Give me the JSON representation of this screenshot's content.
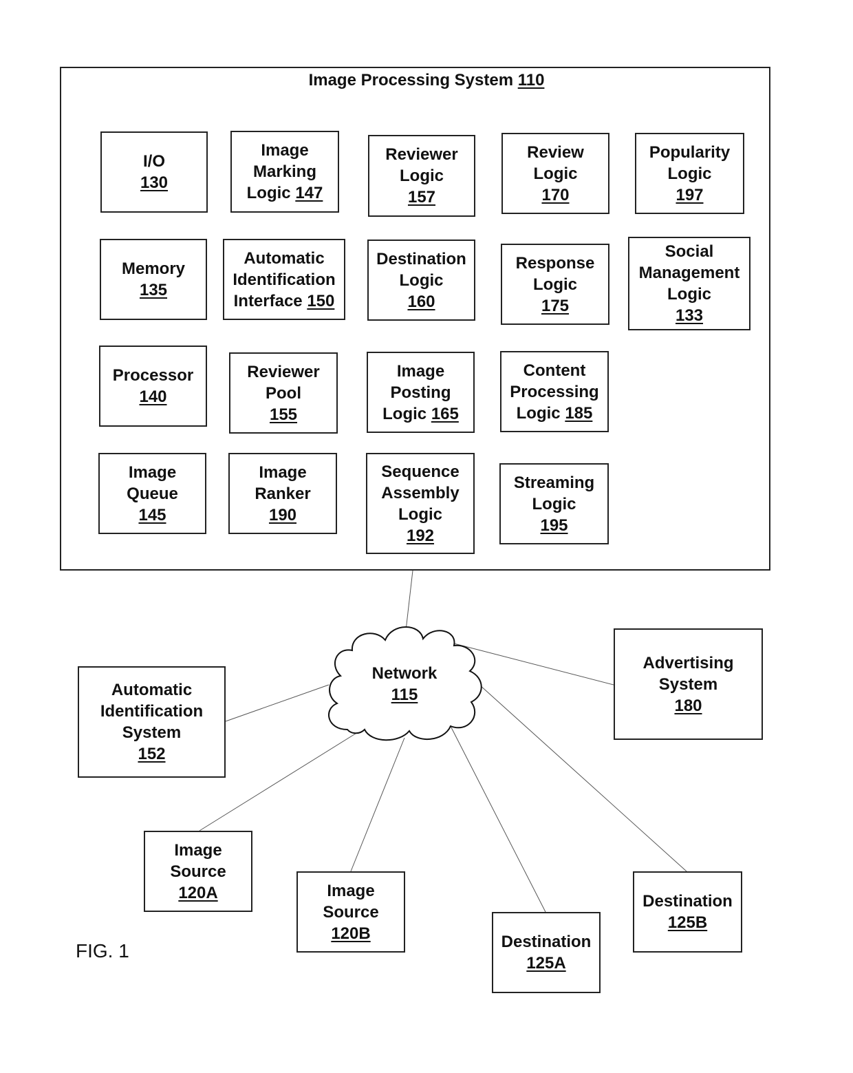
{
  "outer_system": {
    "name": "Image Processing System",
    "ref": "110"
  },
  "components": [
    {
      "id": "io",
      "lines": [
        "I/O"
      ],
      "ref": "130"
    },
    {
      "id": "image-marking-logic",
      "lines": [
        "Image",
        "Marking"
      ],
      "last_prefix": "Logic ",
      "ref": "147"
    },
    {
      "id": "reviewer-logic",
      "lines": [
        "Reviewer",
        "Logic"
      ],
      "ref": "157"
    },
    {
      "id": "review-logic",
      "lines": [
        "Review",
        "Logic"
      ],
      "ref": "170"
    },
    {
      "id": "popularity-logic",
      "lines": [
        "Popularity",
        "Logic"
      ],
      "ref": "197"
    },
    {
      "id": "memory",
      "lines": [
        "Memory"
      ],
      "ref": "135"
    },
    {
      "id": "automatic-identification-interface",
      "lines": [
        "Automatic",
        "Identification"
      ],
      "last_prefix": "Interface ",
      "ref": "150"
    },
    {
      "id": "destination-logic",
      "lines": [
        "Destination",
        "Logic"
      ],
      "ref": "160"
    },
    {
      "id": "response-logic",
      "lines": [
        "Response",
        "Logic"
      ],
      "ref": "175"
    },
    {
      "id": "social-management-logic",
      "lines": [
        "Social",
        "Management",
        "Logic"
      ],
      "ref": "133"
    },
    {
      "id": "processor",
      "lines": [
        "Processor"
      ],
      "ref": "140"
    },
    {
      "id": "reviewer-pool",
      "lines": [
        "Reviewer",
        "Pool"
      ],
      "ref": "155"
    },
    {
      "id": "image-posting-logic",
      "lines": [
        "Image",
        "Posting"
      ],
      "last_prefix": "Logic ",
      "ref": "165"
    },
    {
      "id": "content-processing-logic",
      "lines": [
        "Content",
        "Processing"
      ],
      "last_prefix": "Logic ",
      "ref": "185"
    },
    {
      "id": "image-queue",
      "lines": [
        "Image",
        "Queue"
      ],
      "ref": "145"
    },
    {
      "id": "image-ranker",
      "lines": [
        "Image",
        "Ranker"
      ],
      "ref": "190"
    },
    {
      "id": "sequence-assembly-logic",
      "lines": [
        "Sequence",
        "Assembly",
        "Logic"
      ],
      "ref": "192"
    },
    {
      "id": "streaming-logic",
      "lines": [
        "Streaming",
        "Logic"
      ],
      "ref": "195"
    }
  ],
  "network": {
    "name": "Network",
    "ref": "115"
  },
  "external": [
    {
      "id": "automatic-identification-system",
      "lines": [
        "Automatic",
        "Identification",
        "System"
      ],
      "ref": "152"
    },
    {
      "id": "advertising-system",
      "lines": [
        "Advertising",
        "System"
      ],
      "ref": "180"
    },
    {
      "id": "image-source-a",
      "lines": [
        "Image",
        "Source"
      ],
      "ref": "120A"
    },
    {
      "id": "image-source-b",
      "lines": [
        "Image",
        "Source"
      ],
      "ref": "120B"
    },
    {
      "id": "destination-a",
      "lines": [
        "Destination"
      ],
      "ref": "125A"
    },
    {
      "id": "destination-b",
      "lines": [
        "Destination"
      ],
      "ref": "125B"
    }
  ],
  "figure_label": "FIG. 1"
}
